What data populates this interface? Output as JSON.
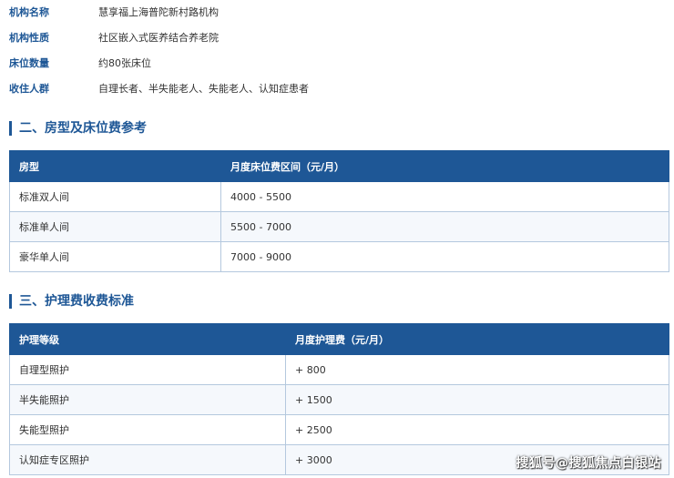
{
  "info": [
    {
      "label": "机构名称",
      "value": "慧享福上海普陀新村路机构"
    },
    {
      "label": "机构性质",
      "value": "社区嵌入式医养结合养老院"
    },
    {
      "label": "床位数量",
      "value": "约80张床位"
    },
    {
      "label": "收住人群",
      "value": "自理长者、半失能老人、失能老人、认知症患者"
    }
  ],
  "room_section": {
    "title": "二、房型及床位费参考",
    "headers": [
      "房型",
      "月度床位费区间（元/月）"
    ],
    "rows": [
      [
        "标准双人间",
        "4000 - 5500"
      ],
      [
        "标准单人间",
        "5500 - 7000"
      ],
      [
        "豪华单人间",
        "7000 - 9000"
      ]
    ]
  },
  "care_section": {
    "title": "三、护理费收费标准",
    "headers": [
      "护理等级",
      "月度护理费（元/月）"
    ],
    "rows": [
      [
        "自理型照护",
        "+ 800"
      ],
      [
        "半失能照护",
        "+ 1500"
      ],
      [
        "失能型照护",
        "+ 2500"
      ],
      [
        "认知症专区照护",
        "+ 3000"
      ]
    ]
  },
  "watermark": "搜狐号@搜狐焦点白银站",
  "colors": {
    "accent": "#1e5796",
    "header_text": "#ffffff",
    "body_text": "#333333",
    "border": "#b4c8de"
  }
}
